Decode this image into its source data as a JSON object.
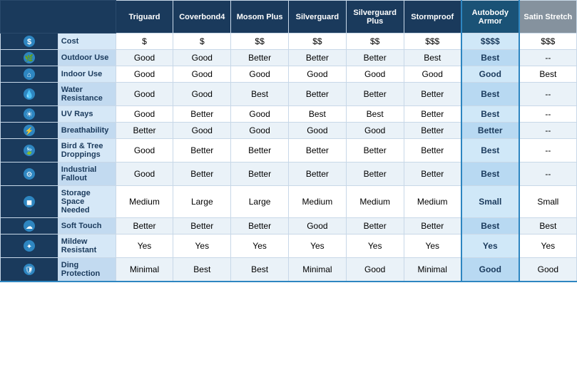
{
  "header": {
    "cols": [
      {
        "label": "Triguard",
        "highlight": false,
        "satin": false
      },
      {
        "label": "Coverbond4",
        "highlight": false,
        "satin": false
      },
      {
        "label": "Mosom Plus",
        "highlight": false,
        "satin": false
      },
      {
        "label": "Silverguard",
        "highlight": false,
        "satin": false
      },
      {
        "label": "Silverguard Plus",
        "highlight": false,
        "satin": false
      },
      {
        "label": "Stormproof",
        "highlight": false,
        "satin": false
      },
      {
        "label": "Autobody Armor",
        "highlight": true,
        "satin": false
      },
      {
        "label": "Satin Stretch",
        "highlight": false,
        "satin": true
      }
    ]
  },
  "rows": [
    {
      "icon": "dollar",
      "label": "Cost",
      "values": [
        "$",
        "$",
        "$$",
        "$$",
        "$$",
        "$$$",
        "$$$$",
        "$$$"
      ]
    },
    {
      "icon": "outdoor",
      "label": "Outdoor Use",
      "values": [
        "Good",
        "Good",
        "Better",
        "Better",
        "Better",
        "Best",
        "Best",
        "--"
      ]
    },
    {
      "icon": "indoor",
      "label": "Indoor Use",
      "values": [
        "Good",
        "Good",
        "Good",
        "Good",
        "Good",
        "Good",
        "Good",
        "Best"
      ]
    },
    {
      "icon": "water",
      "label": "Water Resistance",
      "values": [
        "Good",
        "Good",
        "Best",
        "Better",
        "Better",
        "Better",
        "Best",
        "--"
      ]
    },
    {
      "icon": "uv",
      "label": "UV Rays",
      "values": [
        "Good",
        "Better",
        "Good",
        "Best",
        "Best",
        "Better",
        "Best",
        "--"
      ]
    },
    {
      "icon": "breath",
      "label": "Breathability",
      "values": [
        "Better",
        "Good",
        "Good",
        "Good",
        "Good",
        "Better",
        "Better",
        "--"
      ]
    },
    {
      "icon": "bird",
      "label": "Bird & Tree Droppings",
      "values": [
        "Good",
        "Better",
        "Better",
        "Better",
        "Better",
        "Better",
        "Best",
        "--"
      ]
    },
    {
      "icon": "industrial",
      "label": "Industrial Fallout",
      "values": [
        "Good",
        "Better",
        "Better",
        "Better",
        "Better",
        "Better",
        "Best",
        "--"
      ]
    },
    {
      "icon": "storage",
      "label": "Storage Space Needed",
      "values": [
        "Medium",
        "Large",
        "Large",
        "Medium",
        "Medium",
        "Medium",
        "Small",
        "Small"
      ]
    },
    {
      "icon": "soft",
      "label": "Soft Touch",
      "values": [
        "Better",
        "Better",
        "Better",
        "Good",
        "Better",
        "Better",
        "Best",
        "Best"
      ]
    },
    {
      "icon": "mildew",
      "label": "Mildew Resistant",
      "values": [
        "Yes",
        "Yes",
        "Yes",
        "Yes",
        "Yes",
        "Yes",
        "Yes",
        "Yes"
      ]
    },
    {
      "icon": "ding",
      "label": "Ding Protection",
      "values": [
        "Minimal",
        "Best",
        "Best",
        "Minimal",
        "Good",
        "Minimal",
        "Good",
        "Good"
      ]
    }
  ],
  "icons": {
    "dollar": "#",
    "outdoor": "🌲",
    "indoor": "🏠",
    "water": "💧",
    "uv": "☀",
    "breath": "⚡",
    "bird": "🍃",
    "industrial": "🏭",
    "storage": "📦",
    "soft": "☁",
    "mildew": "●",
    "ding": "🛡"
  }
}
